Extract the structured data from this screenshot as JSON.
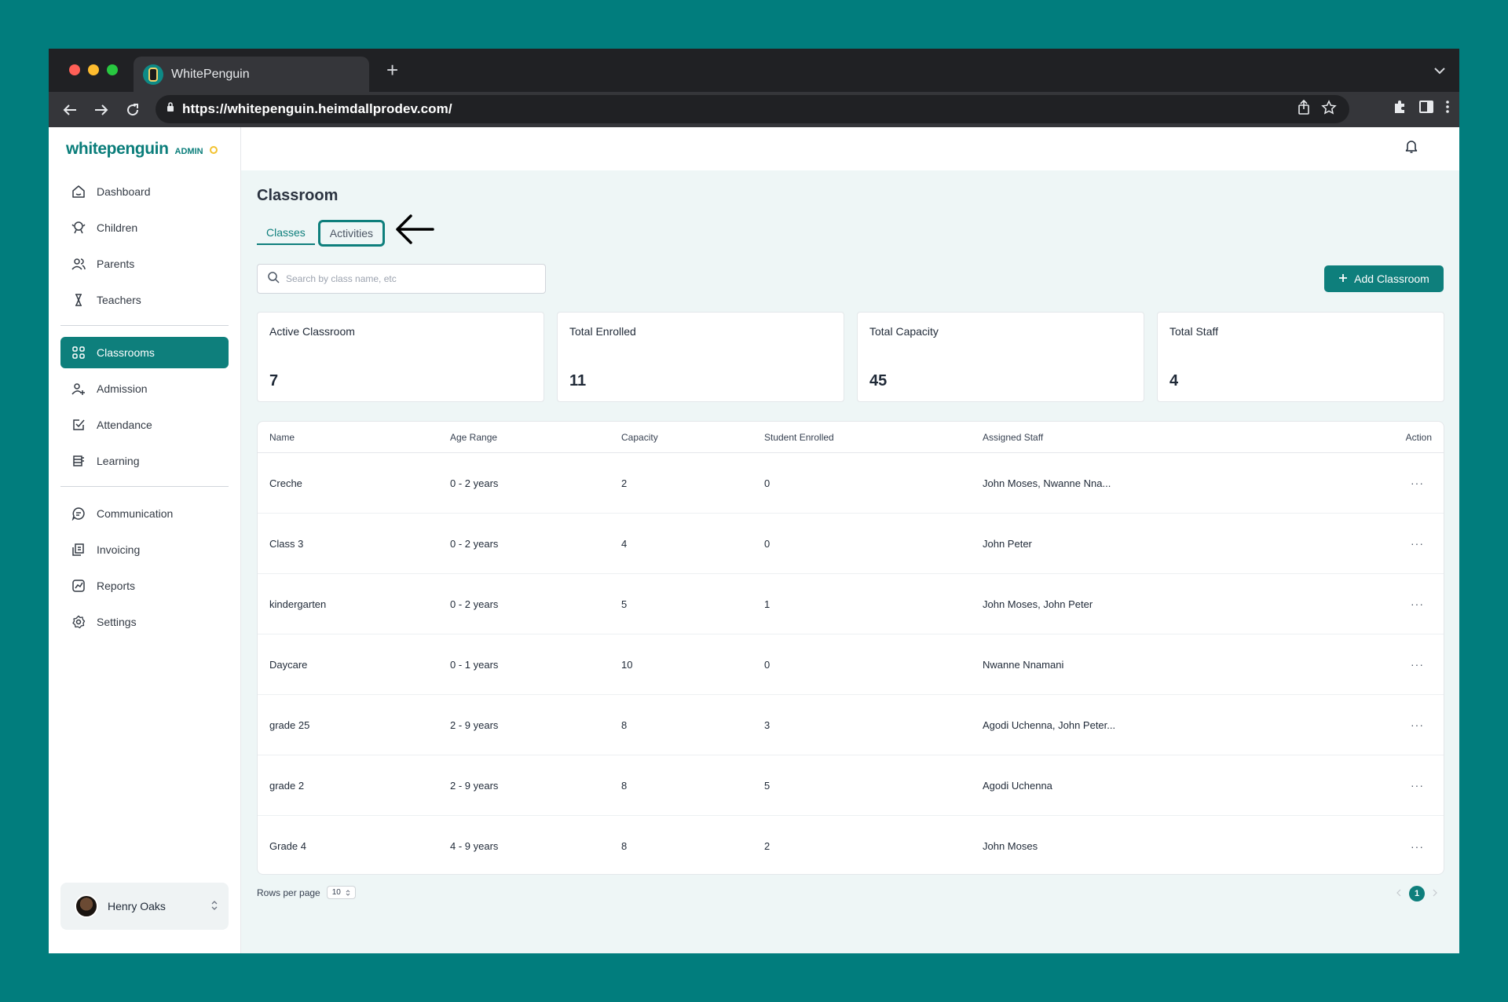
{
  "browser": {
    "tab_title": "WhitePenguin",
    "url": "https://whitepenguin.heimdallprodev.com/"
  },
  "sidebar": {
    "logo_text": "whitepenguin",
    "logo_role": "ADMIN",
    "items": [
      {
        "label": "Dashboard",
        "icon": "dashboard-icon"
      },
      {
        "label": "Children",
        "icon": "children-icon"
      },
      {
        "label": "Parents",
        "icon": "parents-icon"
      },
      {
        "label": "Teachers",
        "icon": "teachers-icon"
      },
      {
        "label": "Classrooms",
        "icon": "classrooms-icon",
        "active": true
      },
      {
        "label": "Admission",
        "icon": "admission-icon"
      },
      {
        "label": "Attendance",
        "icon": "attendance-icon"
      },
      {
        "label": "Learning",
        "icon": "learning-icon"
      },
      {
        "label": "Communication",
        "icon": "communication-icon"
      },
      {
        "label": "Invoicing",
        "icon": "invoicing-icon"
      },
      {
        "label": "Reports",
        "icon": "reports-icon"
      },
      {
        "label": "Settings",
        "icon": "settings-icon"
      }
    ],
    "user": {
      "name": "Henry Oaks"
    }
  },
  "page": {
    "title": "Classroom",
    "tabs": [
      "Classes",
      "Activities"
    ],
    "search_placeholder": "Search by class name, etc",
    "add_button": "Add Classroom"
  },
  "stats": [
    {
      "label": "Active Classroom",
      "value": "7"
    },
    {
      "label": "Total Enrolled",
      "value": "11"
    },
    {
      "label": "Total Capacity",
      "value": "45"
    },
    {
      "label": "Total Staff",
      "value": "4"
    }
  ],
  "table": {
    "headers": [
      "Name",
      "Age Range",
      "Capacity",
      "Student Enrolled",
      "Assigned Staff",
      "Action"
    ],
    "rows": [
      [
        "Creche",
        "0 - 2 years",
        "2",
        "0",
        "John Moses, Nwanne Nna..."
      ],
      [
        "Class 3",
        "0 - 2 years",
        "4",
        "0",
        "John Peter"
      ],
      [
        "kindergarten",
        "0 - 2 years",
        "5",
        "1",
        "John Moses, John Peter"
      ],
      [
        "Daycare",
        "0 - 1 years",
        "10",
        "0",
        "Nwanne Nnamani"
      ],
      [
        "grade 25",
        "2 - 9 years",
        "8",
        "3",
        "Agodi Uchenna, John Peter..."
      ],
      [
        "grade 2",
        "2 - 9 years",
        "8",
        "5",
        "Agodi Uchenna"
      ],
      [
        "Grade 4",
        "4 - 9 years",
        "8",
        "2",
        "John Moses"
      ]
    ],
    "action_glyph": "···"
  },
  "pagination": {
    "rows_per_page_label": "Rows per page",
    "rows_per_page_value": "10",
    "current_page": "1"
  },
  "colors": {
    "brand": "#0e7f7c",
    "background": "#017d7d",
    "main_bg": "#eef6f6"
  }
}
